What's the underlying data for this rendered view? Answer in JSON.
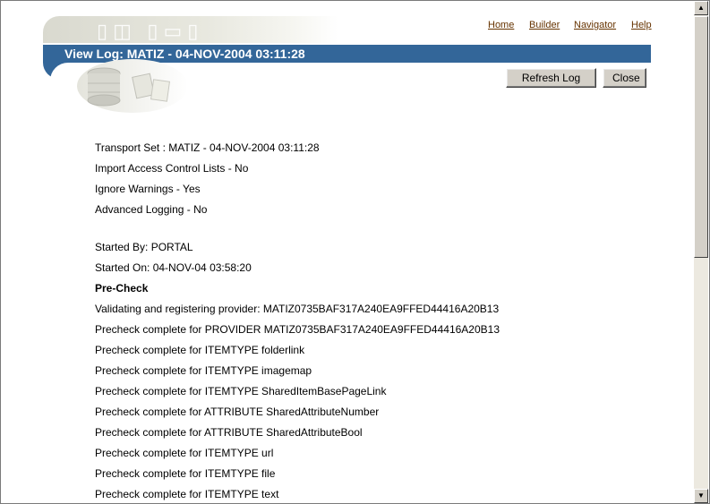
{
  "header": {
    "title": "View Log: MATIZ - 04-NOV-2004 03:11:28",
    "nav_links": [
      "Home",
      "Builder",
      "Navigator",
      "Help"
    ]
  },
  "buttons": {
    "refresh_label": "Refresh Log",
    "close_label": "Close"
  },
  "log": {
    "settings": [
      "Transport Set : MATIZ - 04-NOV-2004 03:11:28",
      "Import Access Control Lists - No",
      "Ignore Warnings - Yes",
      "Advanced Logging - No"
    ],
    "started_by": "Started By: PORTAL",
    "started_on": "Started On: 04-NOV-04 03:58:20",
    "section_heading": "Pre-Check",
    "entries": [
      "Validating and registering provider: MATIZ0735BAF317A240EA9FFED44416A20B13",
      "Precheck complete for PROVIDER MATIZ0735BAF317A240EA9FFED44416A20B13",
      "Precheck complete for ITEMTYPE folderlink",
      "Precheck complete for ITEMTYPE imagemap",
      "Precheck complete for ITEMTYPE SharedItemBasePageLink",
      "Precheck complete for ATTRIBUTE SharedAttributeNumber",
      "Precheck complete for ATTRIBUTE SharedAttributeBool",
      "Precheck complete for ITEMTYPE url",
      "Precheck complete for ITEMTYPE file",
      "Precheck complete for ITEMTYPE text"
    ]
  },
  "colors": {
    "title_bar": "#336699",
    "link": "#663300"
  }
}
